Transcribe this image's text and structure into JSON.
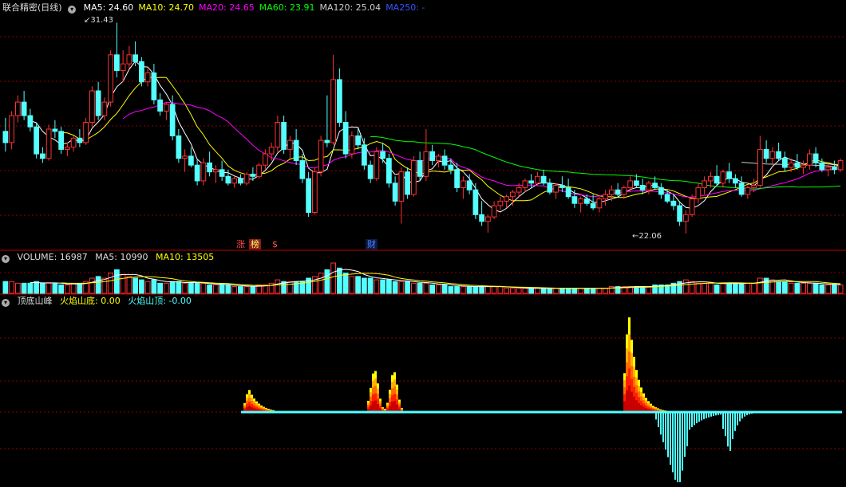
{
  "main_panel": {
    "title": "联合精密(日线)",
    "ma_items": [
      {
        "label": "MA5: 24.60",
        "color": "#ffffff"
      },
      {
        "label": "MA10: 24.70",
        "color": "#ffff00"
      },
      {
        "label": "MA20: 24.65",
        "color": "#ff00ff"
      },
      {
        "label": "MA60: 23.91",
        "color": "#00ff00"
      },
      {
        "label": "MA120: 25.04",
        "color": "#cccccc"
      },
      {
        "label": "MA250: -",
        "color": "#3355ff"
      }
    ],
    "high_label": "31.43",
    "low_label": "22.06",
    "event_tags": [
      "涨",
      "榜",
      "$",
      "财"
    ]
  },
  "volume_panel": {
    "title": "VOLUME: 16987",
    "ma5": "MA5: 10990",
    "ma10": "MA10: 13505"
  },
  "indicator_panel": {
    "title": "顶底山峰",
    "bottom_label": "火焰山底: 0.00",
    "top_label": "火焰山顶: -0.00"
  },
  "colors": {
    "up": "#ff3232",
    "down": "#54ffff",
    "bg": "#000000",
    "grid": "#8b0000"
  },
  "chart_data": {
    "type": "candlestick",
    "price_high": 31.43,
    "price_low": 22.06,
    "candles": [
      [
        26.6,
        27.2,
        25.7,
        26.1
      ],
      [
        26.1,
        27.5,
        25.8,
        27.3
      ],
      [
        27.3,
        28.2,
        27.0,
        27.9
      ],
      [
        27.9,
        28.4,
        27.1,
        27.3
      ],
      [
        27.3,
        27.6,
        26.6,
        26.8
      ],
      [
        26.8,
        27.0,
        25.4,
        25.6
      ],
      [
        25.6,
        25.9,
        25.2,
        25.4
      ],
      [
        25.4,
        26.9,
        25.3,
        26.7
      ],
      [
        26.7,
        27.1,
        26.3,
        26.6
      ],
      [
        26.6,
        26.8,
        25.6,
        25.8
      ],
      [
        25.8,
        26.1,
        25.5,
        25.9
      ],
      [
        25.9,
        26.4,
        25.7,
        26.3
      ],
      [
        26.3,
        26.7,
        25.9,
        26.1
      ],
      [
        26.1,
        27.2,
        26.0,
        27.0
      ],
      [
        27.0,
        28.6,
        26.8,
        28.4
      ],
      [
        28.4,
        28.8,
        27.1,
        27.3
      ],
      [
        27.3,
        28.1,
        27.1,
        27.9
      ],
      [
        27.9,
        30.2,
        27.7,
        30.0
      ],
      [
        30.0,
        31.43,
        29.0,
        29.3
      ],
      [
        29.3,
        30.2,
        28.8,
        29.6
      ],
      [
        29.6,
        30.4,
        29.4,
        30.0
      ],
      [
        30.0,
        30.6,
        29.5,
        29.7
      ],
      [
        29.7,
        29.9,
        28.6,
        28.8
      ],
      [
        28.8,
        29.4,
        28.6,
        29.2
      ],
      [
        29.2,
        29.6,
        27.8,
        28.0
      ],
      [
        28.0,
        28.3,
        27.3,
        27.5
      ],
      [
        27.5,
        27.9,
        27.1,
        27.8
      ],
      [
        27.8,
        28.2,
        26.2,
        26.4
      ],
      [
        26.4,
        26.7,
        25.2,
        25.4
      ],
      [
        25.4,
        25.8,
        24.8,
        25.5
      ],
      [
        25.5,
        25.9,
        25.0,
        25.1
      ],
      [
        25.1,
        25.4,
        24.2,
        24.4
      ],
      [
        24.4,
        25.4,
        24.2,
        25.2
      ],
      [
        25.2,
        25.7,
        24.6,
        24.8
      ],
      [
        24.8,
        25.1,
        24.3,
        24.9
      ],
      [
        24.9,
        25.3,
        24.4,
        24.6
      ],
      [
        24.6,
        24.9,
        24.2,
        24.3
      ],
      [
        24.3,
        24.6,
        24.1,
        24.5
      ],
      [
        24.5,
        24.7,
        24.2,
        24.3
      ],
      [
        24.3,
        24.8,
        24.2,
        24.7
      ],
      [
        24.7,
        25.0,
        24.4,
        24.6
      ],
      [
        24.6,
        25.2,
        24.5,
        25.1
      ],
      [
        25.1,
        25.8,
        24.9,
        25.6
      ],
      [
        25.6,
        26.1,
        25.3,
        25.9
      ],
      [
        25.9,
        27.3,
        25.7,
        27.0
      ],
      [
        27.0,
        27.3,
        25.6,
        25.8
      ],
      [
        25.8,
        26.4,
        25.4,
        26.2
      ],
      [
        26.2,
        26.7,
        25.1,
        25.3
      ],
      [
        25.3,
        25.6,
        24.3,
        24.5
      ],
      [
        24.5,
        24.8,
        22.8,
        23.0
      ],
      [
        23.0,
        25.0,
        22.9,
        24.8
      ],
      [
        24.8,
        26.4,
        24.6,
        26.2
      ],
      [
        26.2,
        28.2,
        25.9,
        26.1
      ],
      [
        26.1,
        30.0,
        26.0,
        28.9
      ],
      [
        28.9,
        29.4,
        26.8,
        27.0
      ],
      [
        27.0,
        27.5,
        25.4,
        25.6
      ],
      [
        25.6,
        26.6,
        25.4,
        26.4
      ],
      [
        26.4,
        26.8,
        25.8,
        26.0
      ],
      [
        26.0,
        26.3,
        24.9,
        25.1
      ],
      [
        25.1,
        25.3,
        24.3,
        24.5
      ],
      [
        24.5,
        25.9,
        24.4,
        25.7
      ],
      [
        25.7,
        26.1,
        25.2,
        25.4
      ],
      [
        25.4,
        25.6,
        24.1,
        24.3
      ],
      [
        24.3,
        24.6,
        23.3,
        23.5
      ],
      [
        23.5,
        25.0,
        22.5,
        24.8
      ],
      [
        24.8,
        25.0,
        23.6,
        23.8
      ],
      [
        23.8,
        25.5,
        23.7,
        25.3
      ],
      [
        25.3,
        25.7,
        24.4,
        24.6
      ],
      [
        24.6,
        26.7,
        24.4,
        25.7
      ],
      [
        25.7,
        26.0,
        25.1,
        25.3
      ],
      [
        25.3,
        25.6,
        25.0,
        25.5
      ],
      [
        25.5,
        25.8,
        24.9,
        25.1
      ],
      [
        25.1,
        25.4,
        24.7,
        24.9
      ],
      [
        24.9,
        25.2,
        23.9,
        24.1
      ],
      [
        24.1,
        24.6,
        23.6,
        24.4
      ],
      [
        24.4,
        24.7,
        23.8,
        24.0
      ],
      [
        24.0,
        24.3,
        22.7,
        22.9
      ],
      [
        22.9,
        23.5,
        22.4,
        22.6
      ],
      [
        22.6,
        22.9,
        22.1,
        22.8
      ],
      [
        22.8,
        23.5,
        22.7,
        23.3
      ],
      [
        23.3,
        23.7,
        23.1,
        23.5
      ],
      [
        23.5,
        23.8,
        23.2,
        23.7
      ],
      [
        23.7,
        24.0,
        23.3,
        23.9
      ],
      [
        23.9,
        24.3,
        23.7,
        24.1
      ],
      [
        24.1,
        24.5,
        23.9,
        24.4
      ],
      [
        24.4,
        24.7,
        24.1,
        24.3
      ],
      [
        24.3,
        24.8,
        24.2,
        24.6
      ],
      [
        24.6,
        24.9,
        24.2,
        24.3
      ],
      [
        24.3,
        24.5,
        23.8,
        23.9
      ],
      [
        23.9,
        24.3,
        23.6,
        24.2
      ],
      [
        24.2,
        24.6,
        23.9,
        24.1
      ],
      [
        24.1,
        24.5,
        23.6,
        23.7
      ],
      [
        23.7,
        24.0,
        23.2,
        23.4
      ],
      [
        23.4,
        23.7,
        23.0,
        23.6
      ],
      [
        23.6,
        23.8,
        23.3,
        23.4
      ],
      [
        23.4,
        23.8,
        23.1,
        23.2
      ],
      [
        23.2,
        23.7,
        23.0,
        23.6
      ],
      [
        23.6,
        24.0,
        23.3,
        23.8
      ],
      [
        23.8,
        24.2,
        23.5,
        24.0
      ],
      [
        24.0,
        24.3,
        23.7,
        23.8
      ],
      [
        23.8,
        24.2,
        23.6,
        24.1
      ],
      [
        24.1,
        24.6,
        23.9,
        24.4
      ],
      [
        24.4,
        24.7,
        24.1,
        24.2
      ],
      [
        24.2,
        24.5,
        23.8,
        24.0
      ],
      [
        24.0,
        24.4,
        23.8,
        24.3
      ],
      [
        24.3,
        24.6,
        24.0,
        24.1
      ],
      [
        24.1,
        24.3,
        23.6,
        23.8
      ],
      [
        23.8,
        24.0,
        23.4,
        23.5
      ],
      [
        23.5,
        23.8,
        23.1,
        23.3
      ],
      [
        23.3,
        23.5,
        22.4,
        22.6
      ],
      [
        22.6,
        23.1,
        22.06,
        22.9
      ],
      [
        22.9,
        23.8,
        22.8,
        23.6
      ],
      [
        23.6,
        24.3,
        23.4,
        24.1
      ],
      [
        24.1,
        24.6,
        23.8,
        24.4
      ],
      [
        24.4,
        24.8,
        24.1,
        24.6
      ],
      [
        24.6,
        25.1,
        24.2,
        24.3
      ],
      [
        24.3,
        24.9,
        24.1,
        24.8
      ],
      [
        24.8,
        25.2,
        24.3,
        24.5
      ],
      [
        24.5,
        24.7,
        24.1,
        24.3
      ],
      [
        24.3,
        24.6,
        23.7,
        23.8
      ],
      [
        23.8,
        24.2,
        23.6,
        24.1
      ],
      [
        24.1,
        24.5,
        23.9,
        24.2
      ],
      [
        24.2,
        26.4,
        24.1,
        25.8
      ],
      [
        25.8,
        26.2,
        25.2,
        25.4
      ],
      [
        25.4,
        25.9,
        25.1,
        25.7
      ],
      [
        25.7,
        26.1,
        25.3,
        25.4
      ],
      [
        25.4,
        25.7,
        24.8,
        25.0
      ],
      [
        25.0,
        25.4,
        24.8,
        25.2
      ],
      [
        25.2,
        25.6,
        24.9,
        25.0
      ],
      [
        25.0,
        25.3,
        24.7,
        25.1
      ],
      [
        25.1,
        25.8,
        24.9,
        25.6
      ],
      [
        25.6,
        25.9,
        25.0,
        25.2
      ],
      [
        25.2,
        25.4,
        24.8,
        24.9
      ],
      [
        24.9,
        25.2,
        24.6,
        25.0
      ],
      [
        25.0,
        25.3,
        24.7,
        24.9
      ],
      [
        24.9,
        25.4,
        24.8,
        25.3
      ]
    ],
    "volume": [
      7,
      7,
      6,
      6,
      6,
      7,
      6,
      6,
      6,
      5,
      5,
      6,
      6,
      7,
      9,
      10,
      9,
      12,
      14,
      11,
      10,
      9,
      8,
      7,
      8,
      6,
      6,
      7,
      7,
      6,
      6,
      6,
      6,
      5,
      5,
      5,
      5,
      4,
      4,
      4,
      4,
      5,
      5,
      6,
      8,
      7,
      7,
      7,
      7,
      9,
      10,
      12,
      14,
      18,
      15,
      12,
      10,
      10,
      9,
      9,
      8,
      8,
      8,
      7,
      7,
      7,
      6,
      6,
      6,
      5,
      5,
      5,
      4,
      4,
      4,
      4,
      4,
      4,
      4,
      4,
      4,
      3,
      3,
      3,
      3,
      3,
      3,
      3,
      3,
      3,
      3,
      3,
      3,
      3,
      3,
      3,
      3,
      3,
      4,
      4,
      4,
      4,
      4,
      4,
      4,
      5,
      5,
      5,
      6,
      7,
      8,
      7,
      6,
      6,
      6,
      5,
      6,
      6,
      6,
      6,
      6,
      6,
      9,
      9,
      8,
      7,
      7,
      6,
      6,
      6,
      6,
      6,
      5,
      5,
      5,
      5
    ],
    "indicator_bottom": [
      0,
      0,
      0,
      0,
      0,
      0,
      0,
      0,
      0,
      0,
      0,
      0,
      0,
      0,
      0,
      0,
      0,
      0,
      0,
      0,
      0,
      0,
      0,
      0,
      0,
      0,
      0,
      0,
      0,
      0,
      0,
      0,
      0,
      0,
      0,
      0,
      0,
      0,
      0,
      0,
      0,
      0,
      0,
      0,
      0,
      0,
      0,
      0,
      0,
      0,
      0,
      0,
      0,
      0,
      0,
      0,
      0,
      0,
      0,
      0,
      0,
      0,
      0,
      0,
      0,
      0,
      0,
      0,
      0,
      0,
      0,
      0,
      0,
      0,
      0,
      0,
      0,
      0,
      0,
      0,
      0,
      0,
      0,
      0,
      0,
      0,
      0,
      0,
      0,
      0,
      0,
      0,
      0,
      0,
      0,
      0,
      0,
      0,
      0,
      0,
      0,
      0,
      0,
      0,
      0,
      0,
      0,
      0,
      0,
      0,
      0,
      0,
      0,
      0,
      0,
      0,
      0,
      0,
      0,
      0,
      0,
      0,
      0,
      0,
      0,
      0,
      0,
      0,
      0,
      0,
      0,
      0,
      0,
      0,
      0,
      0
    ],
    "indicator_top": [
      0,
      0,
      0,
      0,
      0,
      0,
      0,
      0,
      0,
      0,
      0,
      0,
      0,
      0,
      0,
      0,
      0,
      0,
      0,
      0,
      0,
      0,
      0,
      0,
      0,
      0,
      0,
      0,
      0,
      0,
      0,
      0,
      0,
      0,
      0,
      0,
      0,
      0,
      0,
      0,
      0,
      0,
      0,
      0,
      0,
      0,
      0,
      0,
      0,
      0,
      0,
      0,
      0,
      0,
      0,
      0,
      0,
      0,
      0,
      0,
      0,
      0,
      0,
      0,
      0,
      0,
      0,
      0,
      0,
      0,
      0,
      0,
      0,
      0,
      0,
      0,
      0,
      0,
      0,
      0,
      0,
      0,
      0,
      0,
      0,
      0,
      0,
      0,
      0,
      0,
      0,
      0,
      0,
      0,
      0,
      0,
      0,
      0,
      0,
      0,
      0,
      0,
      0,
      0,
      0,
      0,
      0,
      0,
      0,
      0,
      0,
      0,
      0,
      0,
      0,
      0,
      0,
      0,
      0,
      0,
      0,
      0,
      0,
      0,
      0,
      0,
      0,
      0,
      0,
      0,
      0,
      0,
      0,
      0,
      0,
      0
    ]
  }
}
